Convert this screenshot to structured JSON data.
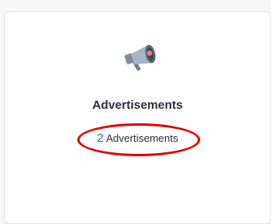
{
  "card": {
    "title": "Advertisements",
    "count": "2",
    "count_label": "Advertisements",
    "icon": "megaphone-icon"
  },
  "annotation": {
    "type": "circle",
    "color": "#e00000"
  }
}
